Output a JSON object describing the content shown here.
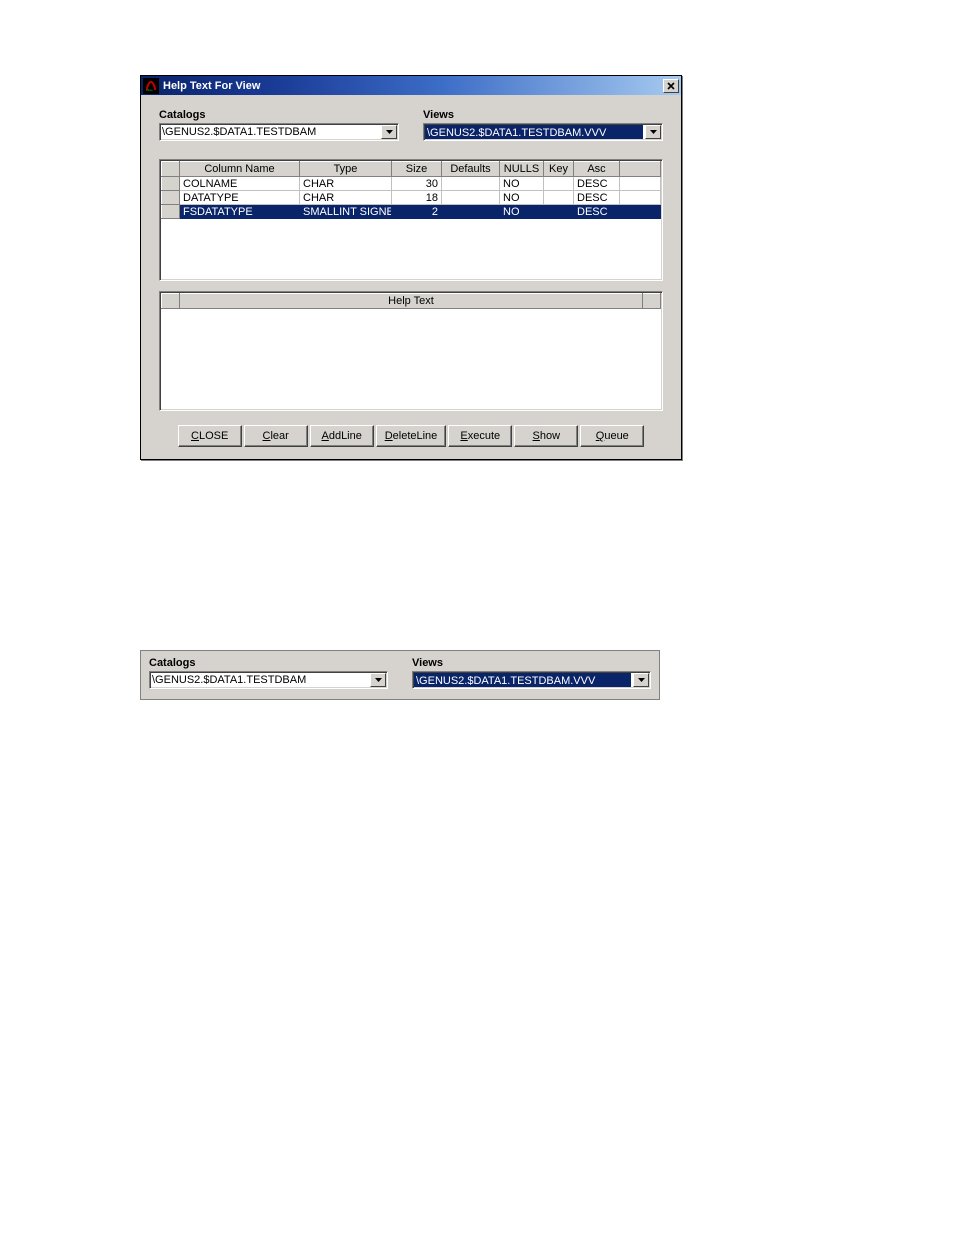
{
  "window": {
    "title": "Help Text  For View",
    "catalogs_label": "Catalogs",
    "views_label": "Views",
    "catalog_value": "\\GENUS2.$DATA1.TESTDBAM",
    "view_value": "\\GENUS2.$DATA1.TESTDBAM.VVV",
    "columns_grid": {
      "headers": [
        "",
        "Column Name",
        "Type",
        "Size",
        "Defaults",
        "NULLS",
        "Key",
        "Asc"
      ],
      "rows": [
        {
          "name": "COLNAME",
          "type": "CHAR",
          "size": "30",
          "defaults": "",
          "nulls": "NO",
          "key": "",
          "asc": "DESC",
          "selected": false
        },
        {
          "name": "DATATYPE",
          "type": "CHAR",
          "size": "18",
          "defaults": "",
          "nulls": "NO",
          "key": "",
          "asc": "DESC",
          "selected": false
        },
        {
          "name": "FSDATATYPE",
          "type": "SMALLINT SIGNE",
          "size": "2",
          "defaults": "",
          "nulls": "NO",
          "key": "",
          "asc": "DESC",
          "selected": true
        }
      ]
    },
    "helptext_header": "Help Text",
    "buttons": {
      "close": {
        "pre": "",
        "u": "C",
        "post": "LOSE"
      },
      "clear": {
        "pre": "",
        "u": "C",
        "post": "lear"
      },
      "addline": {
        "pre": "",
        "u": "A",
        "post": "ddLine"
      },
      "deleteline": {
        "pre": "",
        "u": "D",
        "post": "eleteLine"
      },
      "execute": {
        "pre": "",
        "u": "E",
        "post": "xecute"
      },
      "show": {
        "pre": "",
        "u": "S",
        "post": "how"
      },
      "queue": {
        "pre": "",
        "u": "Q",
        "post": "ueue"
      }
    }
  },
  "snippet2": {
    "catalogs_label": "Catalogs",
    "views_label": "Views",
    "catalog_value": "\\GENUS2.$DATA1.TESTDBAM",
    "view_value": "\\GENUS2.$DATA1.TESTDBAM.VVV"
  }
}
